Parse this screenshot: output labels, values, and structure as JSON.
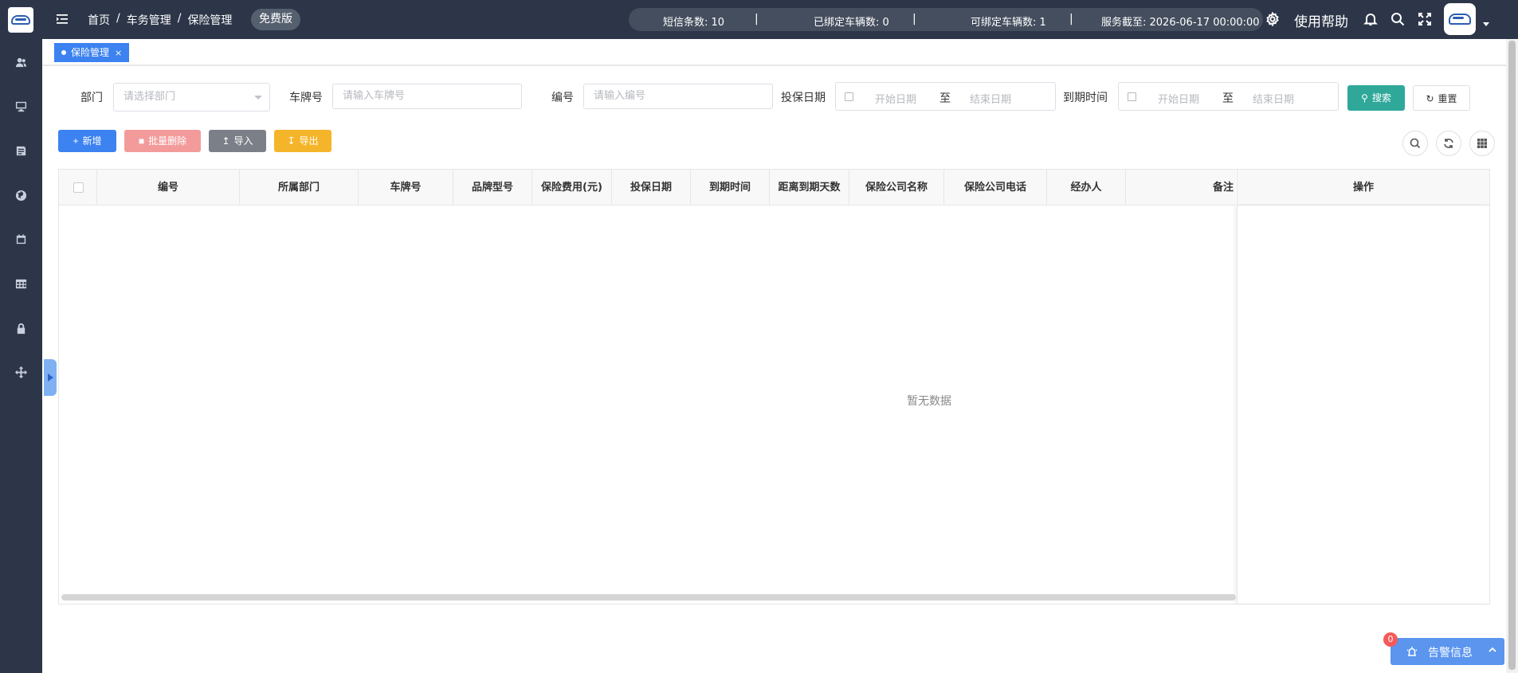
{
  "header": {
    "breadcrumb": [
      "首页",
      "车务管理",
      "保险管理"
    ],
    "breadcrumb_sep": "/",
    "edition": "免费版",
    "stats": {
      "sms": "短信条数: 10",
      "bound": "已绑定车辆数: 0",
      "bindable": "可绑定车辆数: 1",
      "service": "服务截至: 2026-06-17 00:00:00",
      "sep": "|"
    },
    "help": "使用帮助"
  },
  "tags": [
    {
      "label": "保险管理",
      "close": "×"
    }
  ],
  "filters": {
    "dept_label": "部门",
    "dept_placeholder": "请选择部门",
    "plate_label": "车牌号",
    "plate_placeholder": "请输入车牌号",
    "code_label": "编号",
    "code_placeholder": "请输入编号",
    "insure_label": "投保日期",
    "expire_label": "到期时间",
    "start_placeholder": "开始日期",
    "end_placeholder": "结束日期",
    "to": "至",
    "search": "搜索",
    "reset": "重置"
  },
  "toolbar": {
    "add": "新增",
    "batch_delete": "批量删除",
    "import": "导入",
    "export": "导出"
  },
  "table": {
    "columns": [
      "编号",
      "所属部门",
      "车牌号",
      "品牌型号",
      "保险费用(元)",
      "投保日期",
      "到期时间",
      "距离到期天数",
      "保险公司名称",
      "保险公司电话",
      "经办人",
      "备注",
      "操作"
    ],
    "empty_text": "暂无数据"
  },
  "alarm": {
    "label": "告警信息",
    "count": "0"
  }
}
